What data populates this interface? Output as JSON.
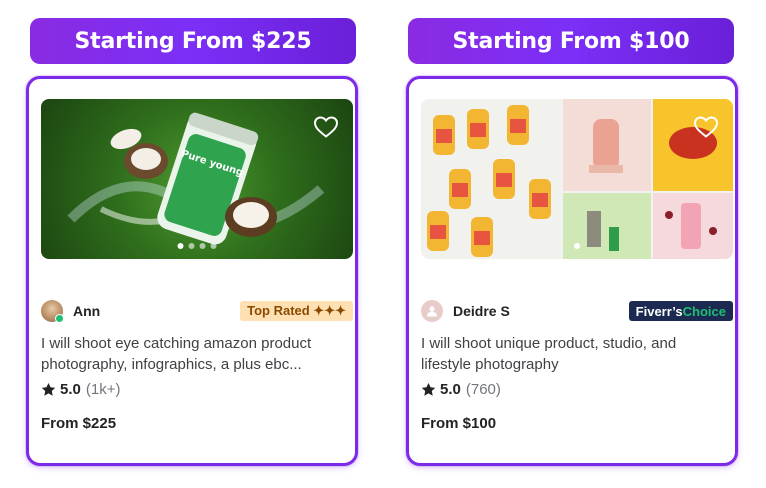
{
  "gigs": [
    {
      "banner": "Starting From $225",
      "seller": "Ann",
      "badge": "Top Rated ✦✦✦",
      "title": "I will shoot eye catching amazon product photography, infographics, a plus ebc...",
      "rating": "5.0",
      "count": "(1k+)",
      "price": "From $225"
    },
    {
      "banner": "Starting From $100",
      "seller": "Deidre S",
      "badge_main": "Fiverr’s ",
      "badge_accent": "Choice",
      "title": "I will shoot unique product, studio, and lifestyle photography",
      "rating": "5.0",
      "count": "(760)",
      "price": "From $100"
    }
  ],
  "colors": {
    "accent": "#7d2ae8",
    "top_rated_bg": "#ffe0b3",
    "choice_bg": "#1c2a52",
    "online": "#1dbf73"
  },
  "icons": [
    "heart-icon",
    "star-icon"
  ]
}
